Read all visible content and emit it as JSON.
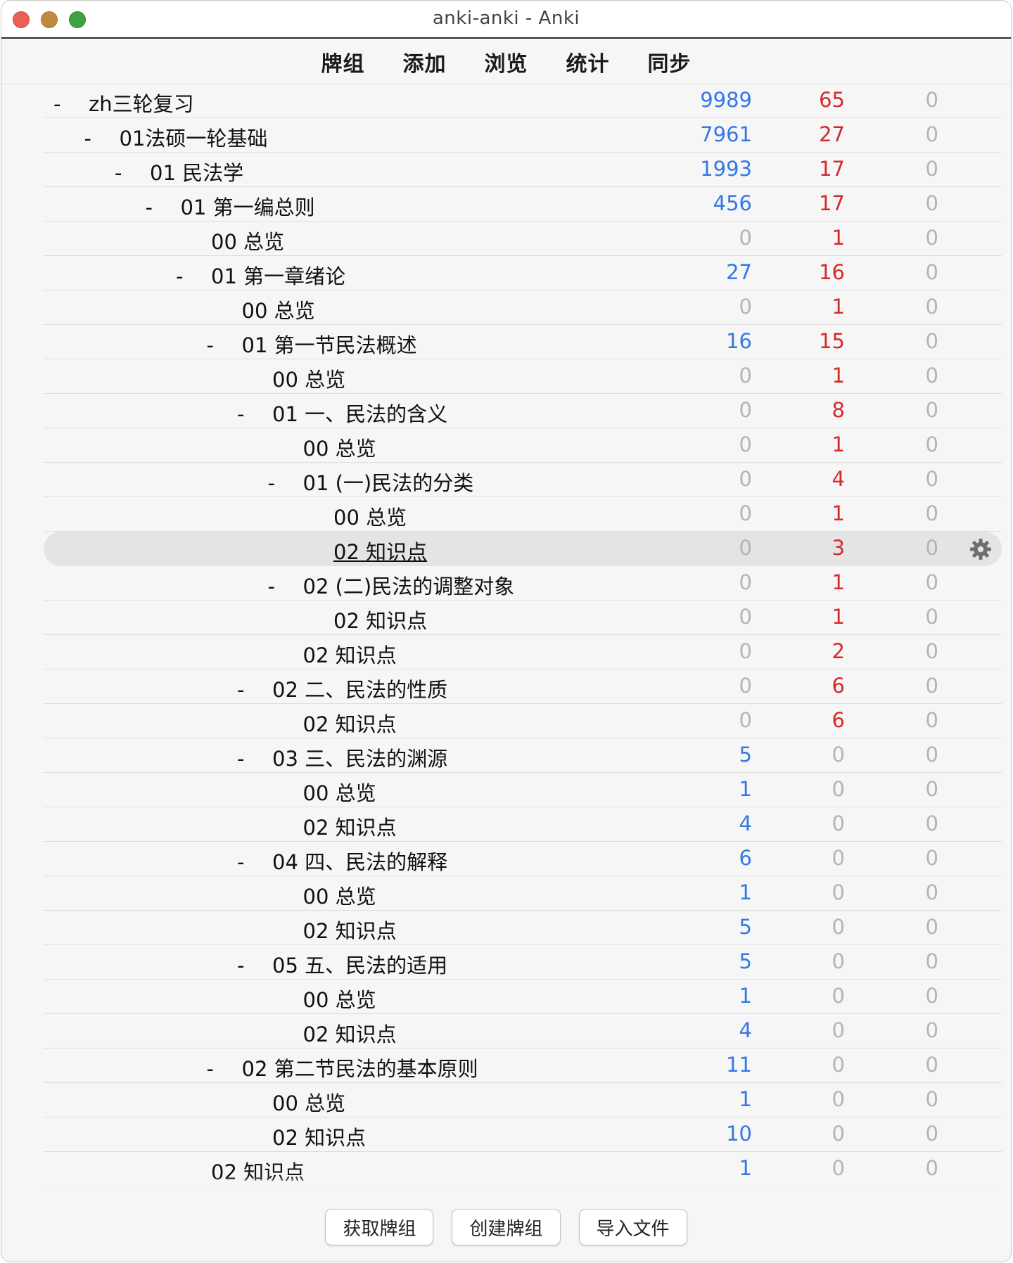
{
  "window": {
    "title": "anki-anki - Anki"
  },
  "toolbar": {
    "items": [
      "牌组",
      "添加",
      "浏览",
      "统计",
      "同步"
    ]
  },
  "colors": {
    "new_count": "#3478e5",
    "learn_count": "#d62a2a",
    "zero_count": "#b4b4b4",
    "current_row": "#e4e4e4"
  },
  "icons": {
    "options": "gear-icon"
  },
  "decks": [
    {
      "depth": 0,
      "collapsible": true,
      "name": "zh三轮复习",
      "new": "9989",
      "learn": "65",
      "due": "0"
    },
    {
      "depth": 1,
      "collapsible": true,
      "name": "01法硕一轮基础",
      "new": "7961",
      "learn": "27",
      "due": "0"
    },
    {
      "depth": 2,
      "collapsible": true,
      "name": "01 民法学",
      "new": "1993",
      "learn": "17",
      "due": "0"
    },
    {
      "depth": 3,
      "collapsible": true,
      "name": "01 第一编总则",
      "new": "456",
      "learn": "17",
      "due": "0"
    },
    {
      "depth": 4,
      "collapsible": false,
      "name": "00 总览",
      "new": "0",
      "learn": "1",
      "due": "0"
    },
    {
      "depth": 4,
      "collapsible": true,
      "name": "01 第一章绪论",
      "new": "27",
      "learn": "16",
      "due": "0"
    },
    {
      "depth": 5,
      "collapsible": false,
      "name": "00 总览",
      "new": "0",
      "learn": "1",
      "due": "0"
    },
    {
      "depth": 5,
      "collapsible": true,
      "name": "01 第一节民法概述",
      "new": "16",
      "learn": "15",
      "due": "0"
    },
    {
      "depth": 6,
      "collapsible": false,
      "name": "00 总览",
      "new": "0",
      "learn": "1",
      "due": "0"
    },
    {
      "depth": 6,
      "collapsible": true,
      "name": "01 一、民法的含义",
      "new": "0",
      "learn": "8",
      "due": "0"
    },
    {
      "depth": 7,
      "collapsible": false,
      "name": "00 总览",
      "new": "0",
      "learn": "1",
      "due": "0"
    },
    {
      "depth": 7,
      "collapsible": true,
      "name": "01 (一)民法的分类",
      "new": "0",
      "learn": "4",
      "due": "0"
    },
    {
      "depth": 8,
      "collapsible": false,
      "name": "00 总览",
      "new": "0",
      "learn": "1",
      "due": "0"
    },
    {
      "depth": 8,
      "collapsible": false,
      "name": "02 知识点",
      "new": "0",
      "learn": "3",
      "due": "0",
      "current": true
    },
    {
      "depth": 7,
      "collapsible": true,
      "name": "02 (二)民法的调整对象",
      "new": "0",
      "learn": "1",
      "due": "0"
    },
    {
      "depth": 8,
      "collapsible": false,
      "name": "02 知识点",
      "new": "0",
      "learn": "1",
      "due": "0"
    },
    {
      "depth": 7,
      "collapsible": false,
      "name": "02 知识点",
      "new": "0",
      "learn": "2",
      "due": "0"
    },
    {
      "depth": 6,
      "collapsible": true,
      "name": "02 二、民法的性质",
      "new": "0",
      "learn": "6",
      "due": "0"
    },
    {
      "depth": 7,
      "collapsible": false,
      "name": "02 知识点",
      "new": "0",
      "learn": "6",
      "due": "0"
    },
    {
      "depth": 6,
      "collapsible": true,
      "name": "03 三、民法的渊源",
      "new": "5",
      "learn": "0",
      "due": "0"
    },
    {
      "depth": 7,
      "collapsible": false,
      "name": "00 总览",
      "new": "1",
      "learn": "0",
      "due": "0"
    },
    {
      "depth": 7,
      "collapsible": false,
      "name": "02 知识点",
      "new": "4",
      "learn": "0",
      "due": "0"
    },
    {
      "depth": 6,
      "collapsible": true,
      "name": "04 四、民法的解释",
      "new": "6",
      "learn": "0",
      "due": "0"
    },
    {
      "depth": 7,
      "collapsible": false,
      "name": "00 总览",
      "new": "1",
      "learn": "0",
      "due": "0"
    },
    {
      "depth": 7,
      "collapsible": false,
      "name": "02 知识点",
      "new": "5",
      "learn": "0",
      "due": "0"
    },
    {
      "depth": 6,
      "collapsible": true,
      "name": "05 五、民法的适用",
      "new": "5",
      "learn": "0",
      "due": "0"
    },
    {
      "depth": 7,
      "collapsible": false,
      "name": "00 总览",
      "new": "1",
      "learn": "0",
      "due": "0"
    },
    {
      "depth": 7,
      "collapsible": false,
      "name": "02 知识点",
      "new": "4",
      "learn": "0",
      "due": "0"
    },
    {
      "depth": 5,
      "collapsible": true,
      "name": "02 第二节民法的基本原则",
      "new": "11",
      "learn": "0",
      "due": "0"
    },
    {
      "depth": 6,
      "collapsible": false,
      "name": "00 总览",
      "new": "1",
      "learn": "0",
      "due": "0"
    },
    {
      "depth": 6,
      "collapsible": false,
      "name": "02 知识点",
      "new": "10",
      "learn": "0",
      "due": "0"
    },
    {
      "depth": 4,
      "collapsible": false,
      "name": "02 知识点",
      "new": "1",
      "learn": "0",
      "due": "0"
    }
  ],
  "bottom": {
    "buttons": [
      "获取牌组",
      "创建牌组",
      "导入文件"
    ]
  }
}
